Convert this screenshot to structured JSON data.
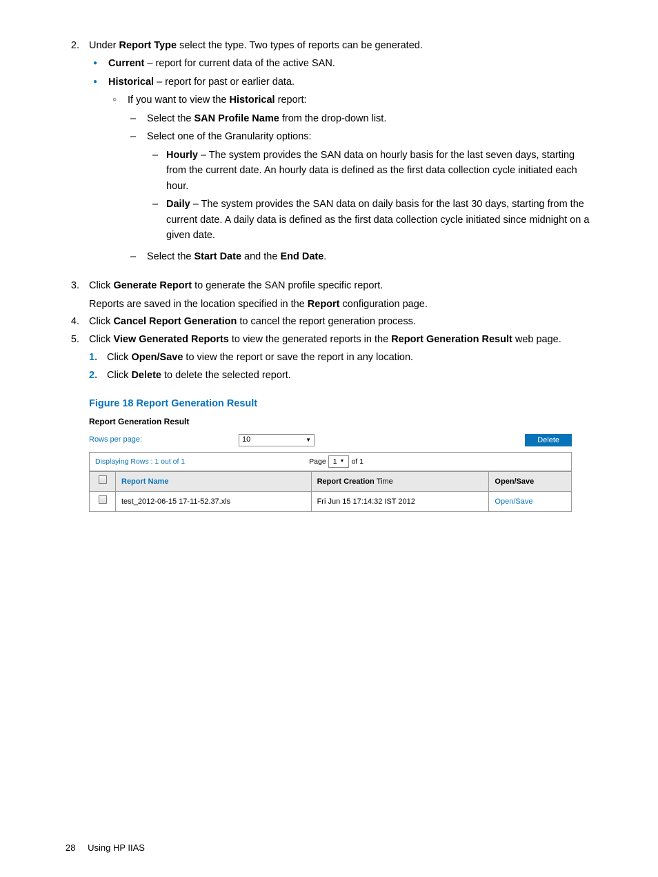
{
  "step2": {
    "num": "2.",
    "text_a": "Under ",
    "b1": "Report Type",
    "text_b": " select the type. Two types of reports can be generated.",
    "current": {
      "b": "Current",
      "t": " – report for current data of the active SAN."
    },
    "historical": {
      "b": "Historical",
      "t": " – report for past or earlier data."
    },
    "hist_view_a": "If you want to view the ",
    "hist_view_b": "Historical",
    "hist_view_c": " report:",
    "sel_san_a": "Select the ",
    "sel_san_b": "SAN Profile Name",
    "sel_san_c": " from the drop-down list.",
    "sel_gran": "Select one of the Granularity options:",
    "hourly_b": "Hourly",
    "hourly_t": "  – The system provides the SAN data on hourly basis for the last seven days, starting from the current date. An hourly data is defined as the first data collection cycle initiated each hour.",
    "daily_b": "Daily",
    "daily_t": " – The system provides the SAN data on daily basis for the last 30 days, starting from the current date. A daily data is defined as the first data collection cycle initiated since midnight on a given date.",
    "sel_dates_a": "Select the ",
    "sel_dates_b": "Start Date",
    "sel_dates_c": " and the ",
    "sel_dates_d": "End Date",
    "sel_dates_e": "."
  },
  "step3": {
    "num": "3.",
    "t1a": "Click ",
    "t1b": "Generate Report",
    "t1c": " to generate the SAN profile specific report.",
    "t2a": "Reports are saved in the location specified in the ",
    "t2b": "Report",
    "t2c": " configuration page."
  },
  "step4": {
    "num": "4.",
    "a": "Click ",
    "b": "Cancel Report Generation",
    "c": " to cancel the report generation process."
  },
  "step5": {
    "num": "5.",
    "a": "Click ",
    "b": "View Generated Reports",
    "c": " to view the generated reports in the ",
    "d": "Report Generation Result",
    "e": " web page.",
    "s1": {
      "n": "1.",
      "a": "Click ",
      "b": "Open/Save",
      "c": " to view the report or save the report in any location."
    },
    "s2": {
      "n": "2.",
      "a": "Click ",
      "b": "Delete",
      "c": " to delete the selected report."
    }
  },
  "figure": {
    "caption": "Figure 18 Report Generation Result"
  },
  "ss": {
    "title": "Report Generation Result",
    "rpp_label": "Rows per page:",
    "rpp_value": "10",
    "delete": "Delete",
    "disp": "Displaying Rows : 1 out of 1",
    "page_a": "Page",
    "page_sel": "1",
    "page_b": "of 1",
    "th_name": "Report Name",
    "th_time_a": "Report Creation ",
    "th_time_b": "Time",
    "th_os": "Open/Save",
    "row_name": "test_2012-06-15 17-11-52.37.xls",
    "row_time": "Fri Jun 15 17:14:32 IST 2012",
    "row_link": "Open/Save"
  },
  "footer": {
    "page": "28",
    "section": "Using HP IIAS"
  }
}
